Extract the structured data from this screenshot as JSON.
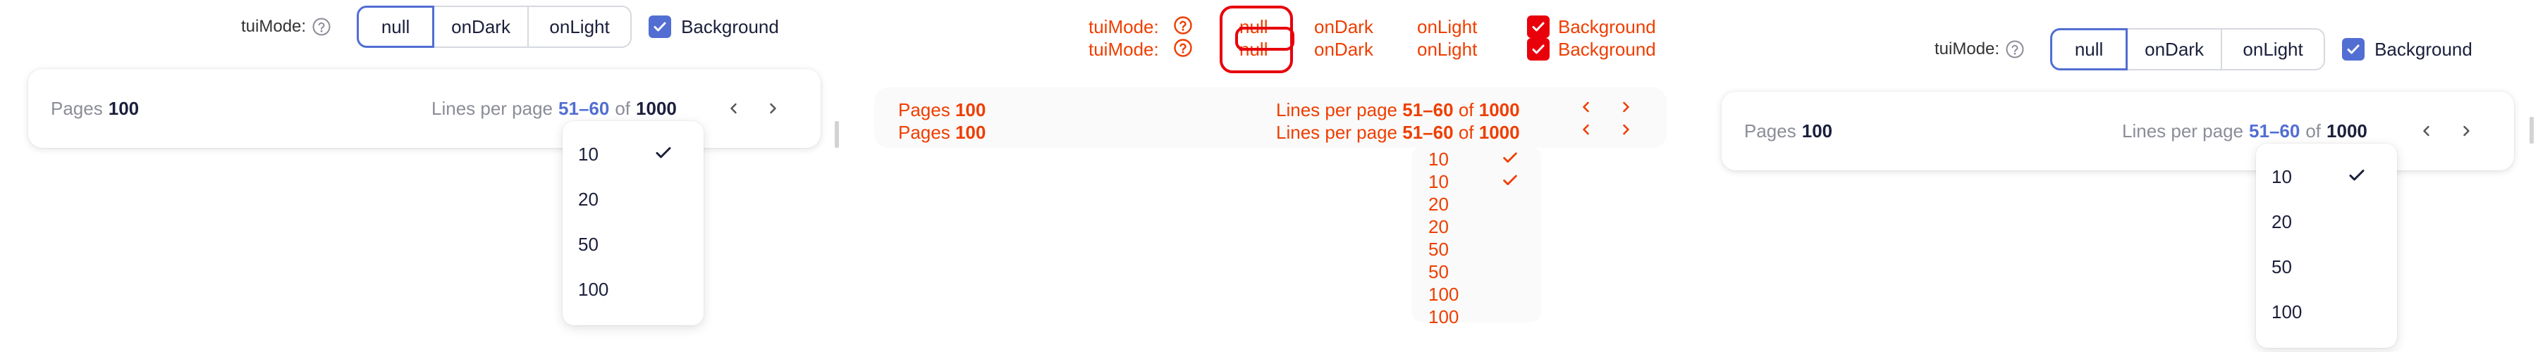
{
  "toolbar": {
    "mode_label": "tuiMode:",
    "modes": [
      "null",
      "onDark",
      "onLight"
    ],
    "active_mode": "null",
    "background_label": "Background",
    "background_checked": true
  },
  "pagination": {
    "pages_label": "Pages",
    "pages_value": "100",
    "lines_label": "Lines per page",
    "range": "51–60",
    "of_label": "of",
    "total": "1000"
  },
  "dropdown": {
    "options": [
      "10",
      "20",
      "50",
      "100"
    ],
    "selected": "10"
  },
  "colors": {
    "accent": "#526ed3",
    "overlay": "#ef3e00",
    "overlay_border": "#e8000b",
    "muted_text": "#8b8d98"
  },
  "icons": {
    "help": "help-circle-icon",
    "check": "check-icon",
    "prev": "chevron-left-icon",
    "next": "chevron-right-icon"
  }
}
